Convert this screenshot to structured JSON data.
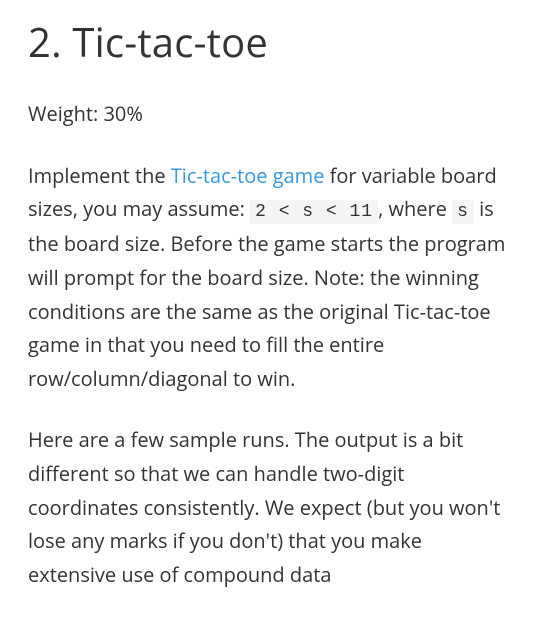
{
  "heading": "2. Tic-tac-toe",
  "weight_line": "Weight: 30%",
  "para1": {
    "t1": "Implement the ",
    "link": "Tic-tac-toe game",
    "t2": " for variable board sizes, you may assume: ",
    "code1": "2 < s < 11",
    "t3": ", where ",
    "code2": "s",
    "t4": " is the board size. Before the game starts the program will prompt for the board size. Note: the winning conditions are the same as the original Tic-tac-toe game in that you need to fill the entire row/column/diagonal to win."
  },
  "para2": "Here are a few sample runs. The output is a bit different so that we can handle two-digit coordinates consistently. We expect (but you won't lose any marks if you don't) that you make extensive use of compound data"
}
